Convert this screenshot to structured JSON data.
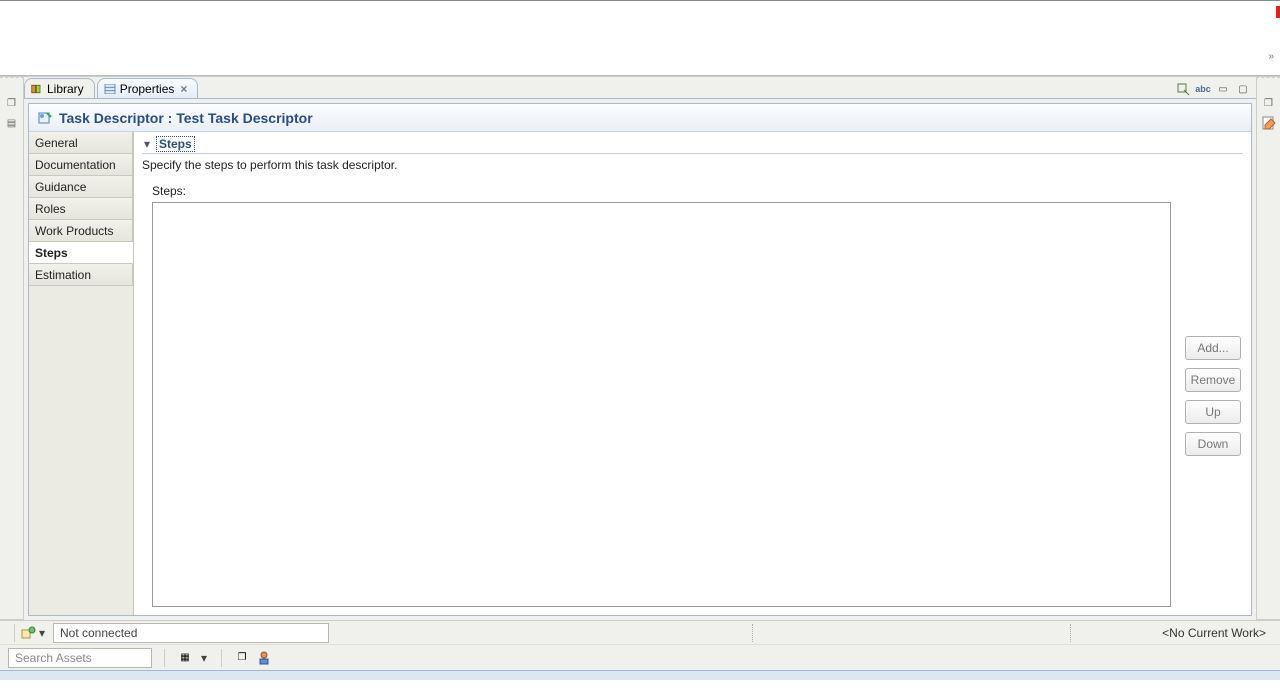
{
  "tabs": {
    "library": "Library",
    "properties": "Properties"
  },
  "editor": {
    "title": "Task Descriptor : Test Task Descriptor"
  },
  "sidenav": {
    "items": [
      "General",
      "Documentation",
      "Guidance",
      "Roles",
      "Work Products",
      "Steps",
      "Estimation"
    ],
    "active_index": 5
  },
  "section": {
    "title": "Steps",
    "desc": "Specify the steps to perform this task descriptor.",
    "list_label": "Steps:"
  },
  "buttons": {
    "add": "Add...",
    "remove": "Remove",
    "up": "Up",
    "down": "Down"
  },
  "status": {
    "connection": "Not connected",
    "work": "<No Current Work>",
    "search_placeholder": "Search Assets"
  }
}
